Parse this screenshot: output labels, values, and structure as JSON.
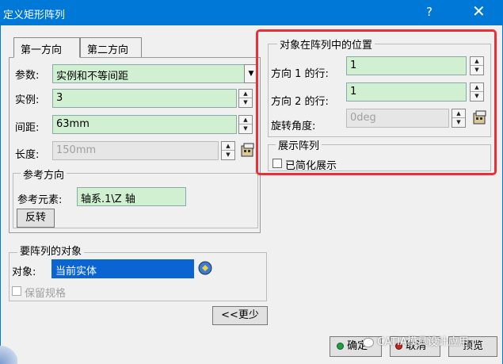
{
  "window": {
    "title": "定义矩形阵列",
    "help": "?",
    "close": "✕"
  },
  "tabs": [
    {
      "label": "第一方向"
    },
    {
      "label": "第二方向"
    }
  ],
  "first_direction": {
    "param_label": "参数:",
    "param_value": "实例和不等间距",
    "instances_label": "实例:",
    "instances_value": "3",
    "spacing_label": "间距:",
    "spacing_value": "63mm",
    "length_label": "长度:",
    "length_value": "150mm"
  },
  "reference": {
    "group_title": "参考方向",
    "element_label": "参考元素:",
    "element_value": "轴系.1\\Z 轴",
    "reverse_button": "反转"
  },
  "position": {
    "group_title": "对象在阵列中的位置",
    "row1_label": "方向 1 的行:",
    "row1_value": "1",
    "row2_label": "方向 2 的行:",
    "row2_value": "1",
    "rotation_label": "旋转角度:",
    "rotation_value": "0deg"
  },
  "display": {
    "group_title": "展示阵列",
    "simplified_label": "已简化展示"
  },
  "object": {
    "group_title": "要阵列的对象",
    "object_label": "对象:",
    "object_value": "当前实体",
    "keep_spec_label": "保留规格"
  },
  "buttons": {
    "less": "<<更少",
    "ok": "确定",
    "cancel": "取消",
    "preview": "预览"
  },
  "watermark": "CATIA模具设计应用"
}
